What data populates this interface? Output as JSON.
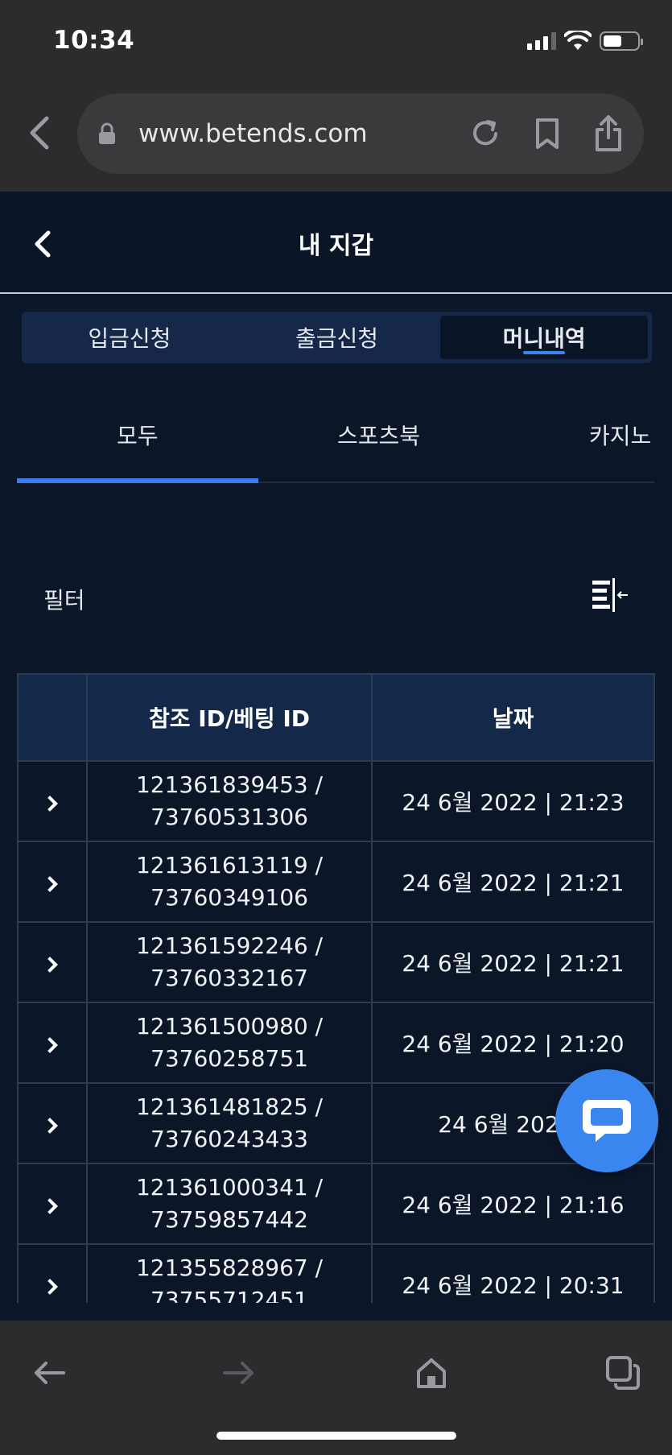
{
  "status_bar": {
    "time": "10:34"
  },
  "browser": {
    "url": "www.betends.com",
    "icons": [
      "back-icon",
      "lock-icon",
      "reload-icon",
      "bookmark-icon",
      "share-icon"
    ]
  },
  "header": {
    "title": "내 지갑"
  },
  "segments": [
    {
      "label": "입금신청",
      "active": false
    },
    {
      "label": "출금신청",
      "active": false
    },
    {
      "label": "머니내역",
      "active": true
    }
  ],
  "subtabs": [
    {
      "label": "모두",
      "active": true
    },
    {
      "label": "스포츠북",
      "active": false
    },
    {
      "label": "카지노",
      "active": false
    }
  ],
  "filter": {
    "label": "필터"
  },
  "table": {
    "headers": [
      "",
      "참조 ID/베팅 ID",
      "날짜"
    ],
    "rows": [
      {
        "ref": "121361839453 /",
        "bet": "73760531306",
        "date": "24 6월 2022 | 21:23"
      },
      {
        "ref": "121361613119 /",
        "bet": "73760349106",
        "date": "24 6월 2022 | 21:21"
      },
      {
        "ref": "121361592246 /",
        "bet": "73760332167",
        "date": "24 6월 2022 | 21:21"
      },
      {
        "ref": "121361500980 /",
        "bet": "73760258751",
        "date": "24 6월 2022 | 21:20"
      },
      {
        "ref": "121361481825 /",
        "bet": "73760243433",
        "date": "24 6월 2022 |"
      },
      {
        "ref": "121361000341 /",
        "bet": "73759857442",
        "date": "24 6월 2022 | 21:16"
      },
      {
        "ref": "121355828967 /",
        "bet": "73755712451",
        "date": "24 6월 2022 | 20:31"
      }
    ]
  },
  "colors": {
    "background": "#0b1628",
    "accent": "#3a86f0",
    "chrome": "#2c2c2e"
  }
}
